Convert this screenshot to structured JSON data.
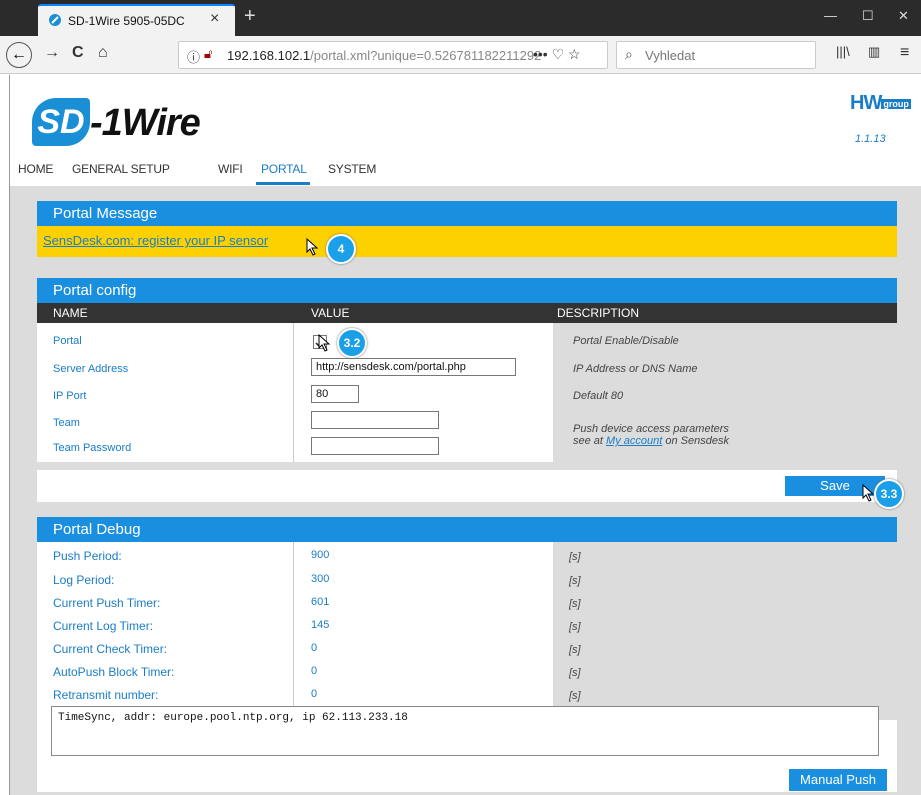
{
  "browser": {
    "tab_title": "SD-1Wire 5905-05DC",
    "tab_close": "×",
    "new_tab": "+",
    "url_host": "192.168.102.1",
    "url_path": "/portal.xml?unique=0.526781182211292",
    "url_icons": "••• ♡ ☆",
    "search_placeholder": "Vyhledat",
    "nav_back": "←",
    "nav_forward": "→",
    "nav_reload": "C",
    "nav_home": "⌂",
    "win_min": "—",
    "win_max": "☐",
    "win_close": "✕",
    "toolbar_library": "|||\\",
    "toolbar_sidebar": "▥",
    "toolbar_menu": "≡"
  },
  "header": {
    "logo_sd": "SD",
    "logo_rest": "-1Wire",
    "brand_main": "HW",
    "brand_small": "group",
    "version": "1.1.13"
  },
  "menu": {
    "items": [
      "HOME",
      "GENERAL SETUP",
      "WIFI",
      "PORTAL",
      "SYSTEM"
    ],
    "active": "PORTAL"
  },
  "portal_message": {
    "title": "Portal Message",
    "link": "SensDesk.com: register your IP sensor"
  },
  "portal_config": {
    "title": "Portal config",
    "columns": [
      "NAME",
      "VALUE",
      "DESCRIPTION"
    ],
    "rows": [
      {
        "name": "Portal",
        "value": "",
        "description": "Portal Enable/Disable"
      },
      {
        "name": "Server Address",
        "value": "http://sensdesk.com/portal.php",
        "description": "IP Address or DNS Name"
      },
      {
        "name": "IP Port",
        "value": "80",
        "description": "Default 80"
      },
      {
        "name": "Team",
        "value": "",
        "description": "Push device access parameters"
      },
      {
        "name": "Team Password",
        "value": "",
        "description": ""
      }
    ],
    "team_desc_line2_pre": "see at",
    "team_desc_link": "My account",
    "team_desc_line2_post": "on Sensdesk",
    "portal_checked": true
  },
  "save": {
    "label": "Save"
  },
  "portal_debug": {
    "title": "Portal Debug",
    "rows": [
      {
        "label": "Push Period:",
        "value": "900",
        "unit": "[s]"
      },
      {
        "label": "Log Period:",
        "value": "300",
        "unit": "[s]"
      },
      {
        "label": "Current Push Timer:",
        "value": "601",
        "unit": "[s]"
      },
      {
        "label": "Current Log Timer:",
        "value": "145",
        "unit": "[s]"
      },
      {
        "label": "Current Check Timer:",
        "value": "0",
        "unit": "[s]"
      },
      {
        "label": "AutoPush Block Timer:",
        "value": "0",
        "unit": "[s]"
      },
      {
        "label": "Retransmit number:",
        "value": "0",
        "unit": "[s]"
      }
    ],
    "log": "TimeSync, addr: europe.pool.ntp.org, ip 62.113.233.18",
    "push_button": "Manual Push"
  },
  "callouts": [
    "4",
    "3.2",
    "3.3"
  ],
  "colors": {
    "accent": "#1a8fe0",
    "message_bar": "#fdd100",
    "table_header": "#333333",
    "content_bg": "#dcdcdc"
  }
}
